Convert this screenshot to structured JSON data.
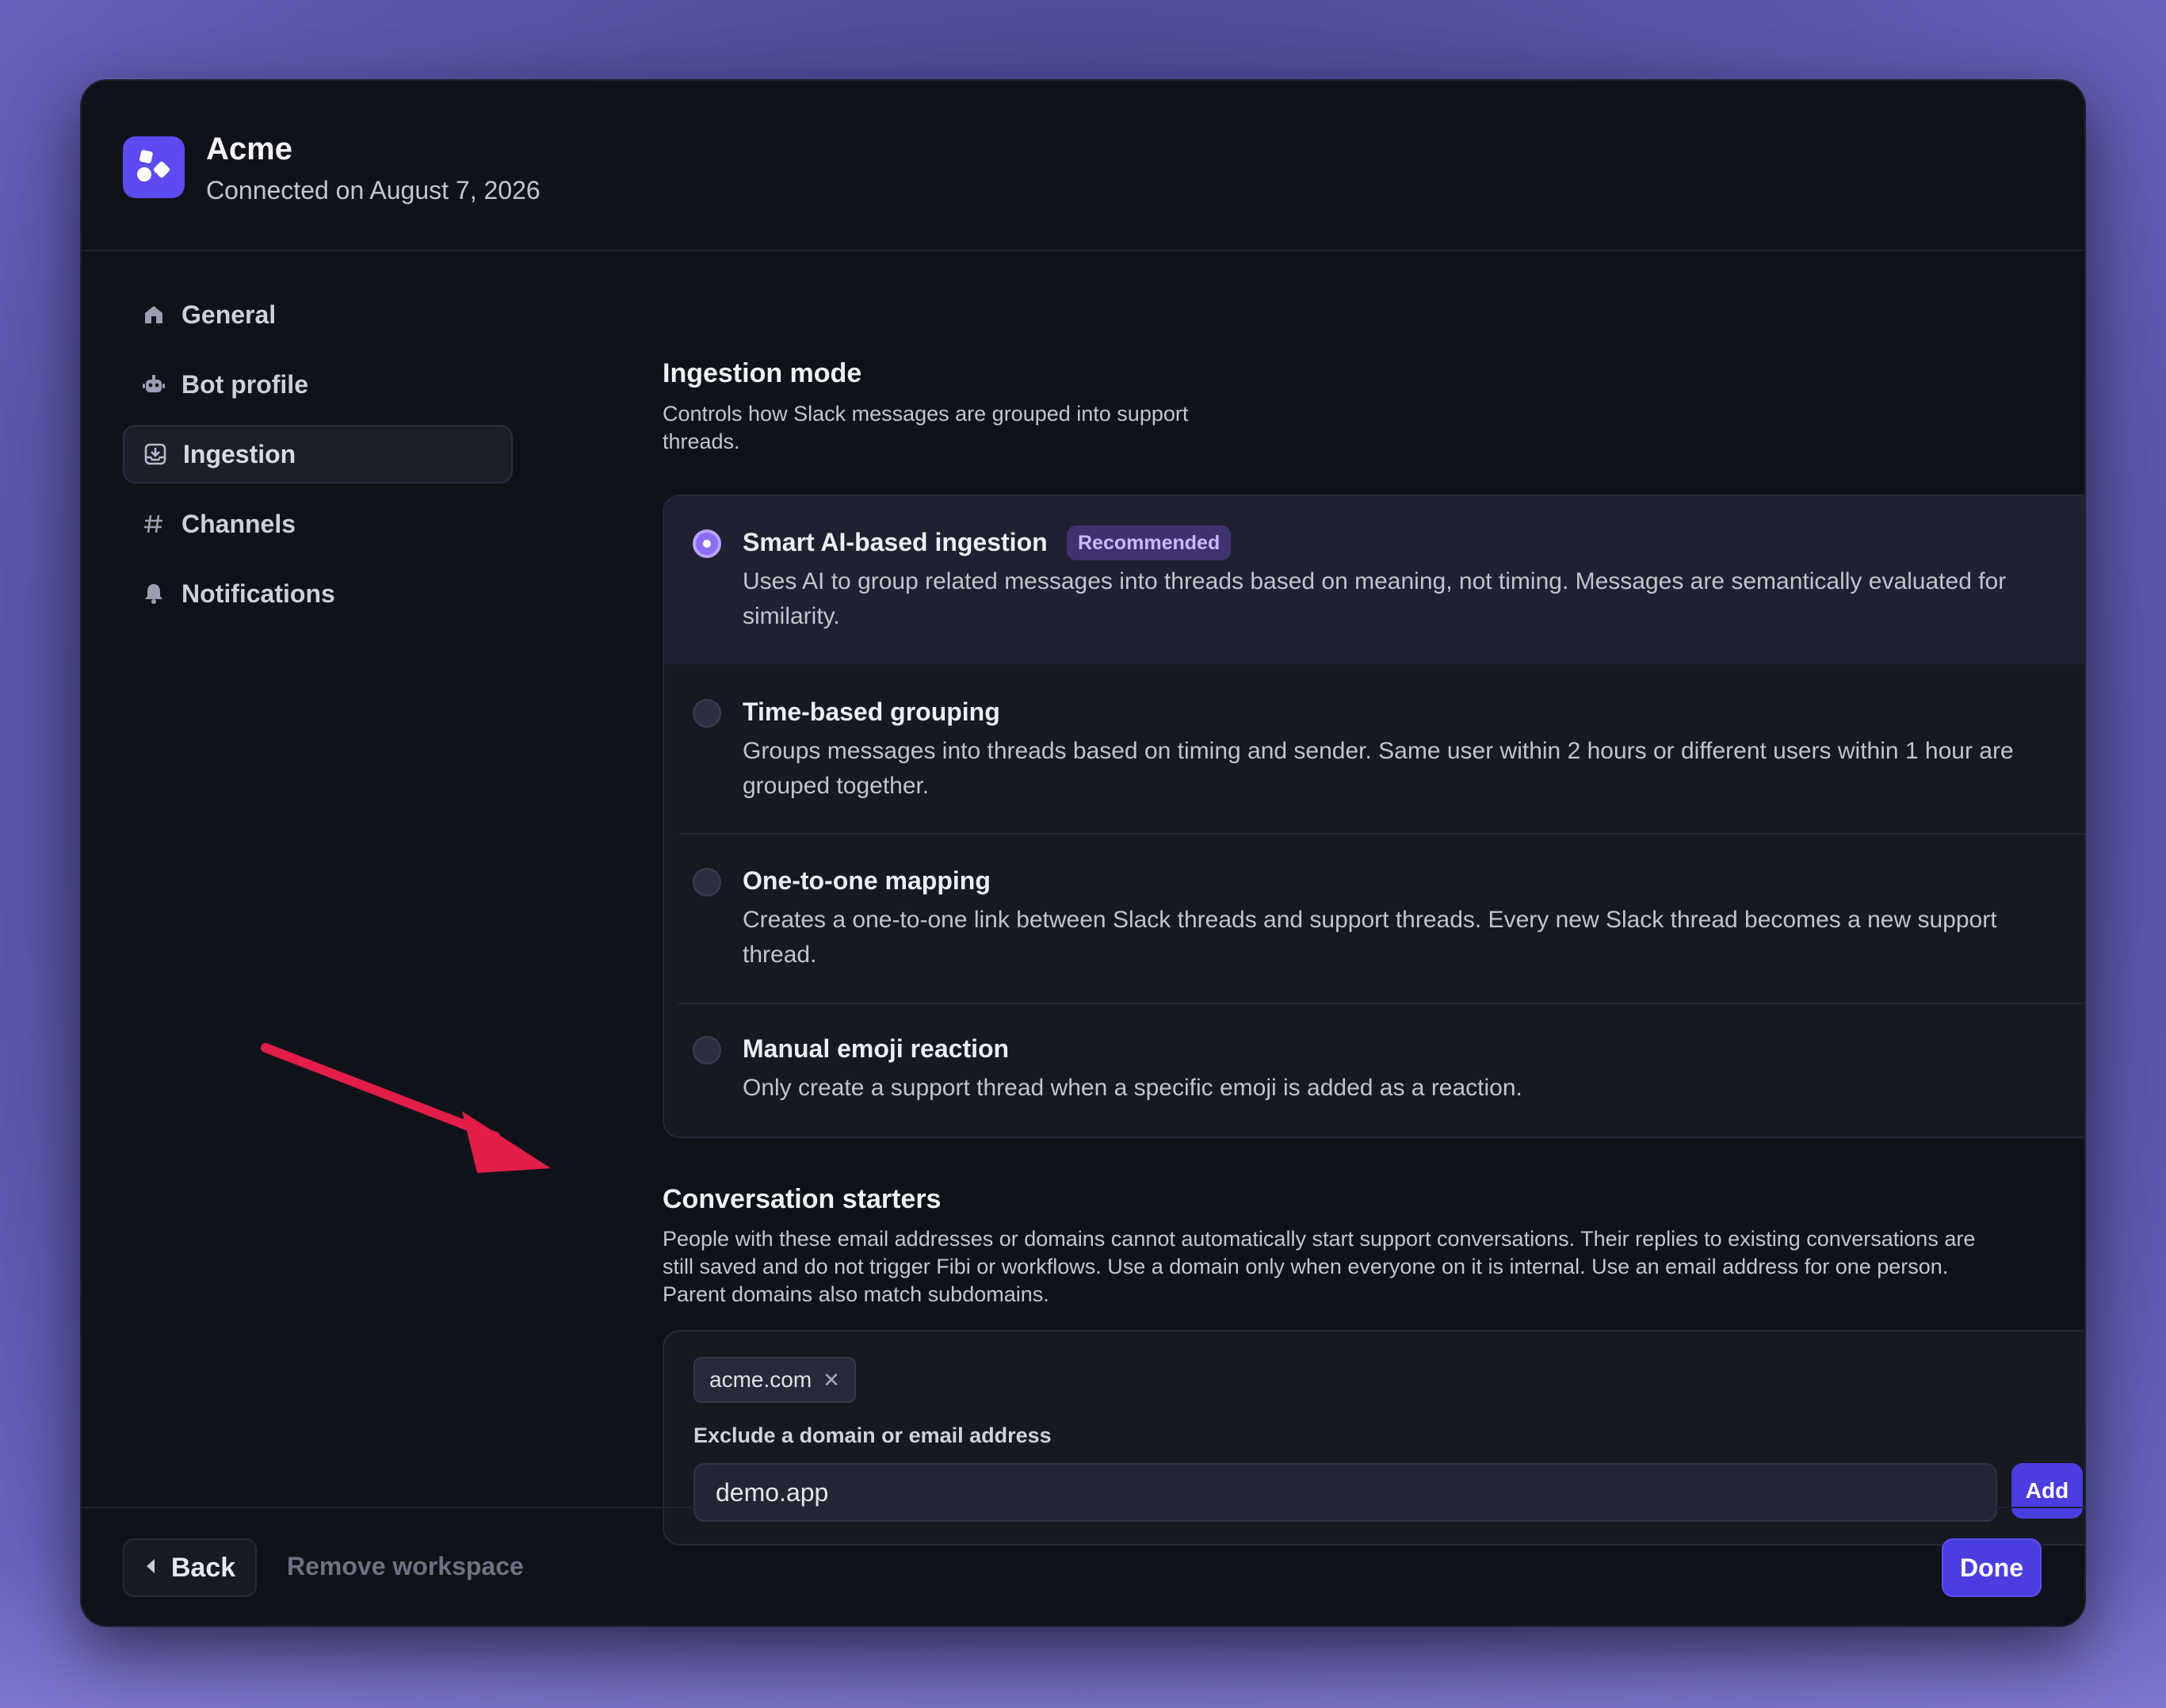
{
  "header": {
    "title": "Acme",
    "subtitle": "Connected on August 7, 2026"
  },
  "sidebar": {
    "items": [
      {
        "label": "General",
        "icon": "home-icon",
        "active": false
      },
      {
        "label": "Bot profile",
        "icon": "bot-icon",
        "active": false
      },
      {
        "label": "Ingestion",
        "icon": "ingestion-icon",
        "active": true
      },
      {
        "label": "Channels",
        "icon": "hash-icon",
        "active": false
      },
      {
        "label": "Notifications",
        "icon": "bell-icon",
        "active": false
      }
    ]
  },
  "ingestion": {
    "title": "Ingestion mode",
    "description": "Controls how Slack messages are grouped into support threads.",
    "options": [
      {
        "title": "Smart AI-based ingestion",
        "badge": "Recommended",
        "description": "Uses AI to group related messages into threads based on meaning, not timing. Messages are semantically evaluated for similarity.",
        "selected": true
      },
      {
        "title": "Time-based grouping",
        "description": "Groups messages into threads based on timing and sender. Same user within 2 hours or different users within 1 hour are grouped together.",
        "selected": false
      },
      {
        "title": "One-to-one mapping",
        "description": "Creates a one-to-one link between Slack threads and support threads. Every new Slack thread becomes a new support thread.",
        "selected": false
      },
      {
        "title": "Manual emoji reaction",
        "description": "Only create a support thread when a specific emoji is added as a reaction.",
        "selected": false
      }
    ]
  },
  "conversation_starters": {
    "title": "Conversation starters",
    "description": "People with these email addresses or domains cannot automatically start support conversations. Their replies to existing conversations are still saved and do not trigger Fibi or workflows. Use a domain only when everyone on it is internal. Use an email address for one person. Parent domains also match subdomains.",
    "chips": [
      "acme.com"
    ],
    "field_label": "Exclude a domain or email address",
    "input_value": "demo.app",
    "add_label": "Add"
  },
  "footer": {
    "back_label": "Back",
    "remove_label": "Remove workspace",
    "done_label": "Done"
  },
  "colors": {
    "accent": "#4b3ee0",
    "selected_radio": "#8b6cf5",
    "badge_bg": "#40326f",
    "annotation_arrow": "#e11d48"
  }
}
